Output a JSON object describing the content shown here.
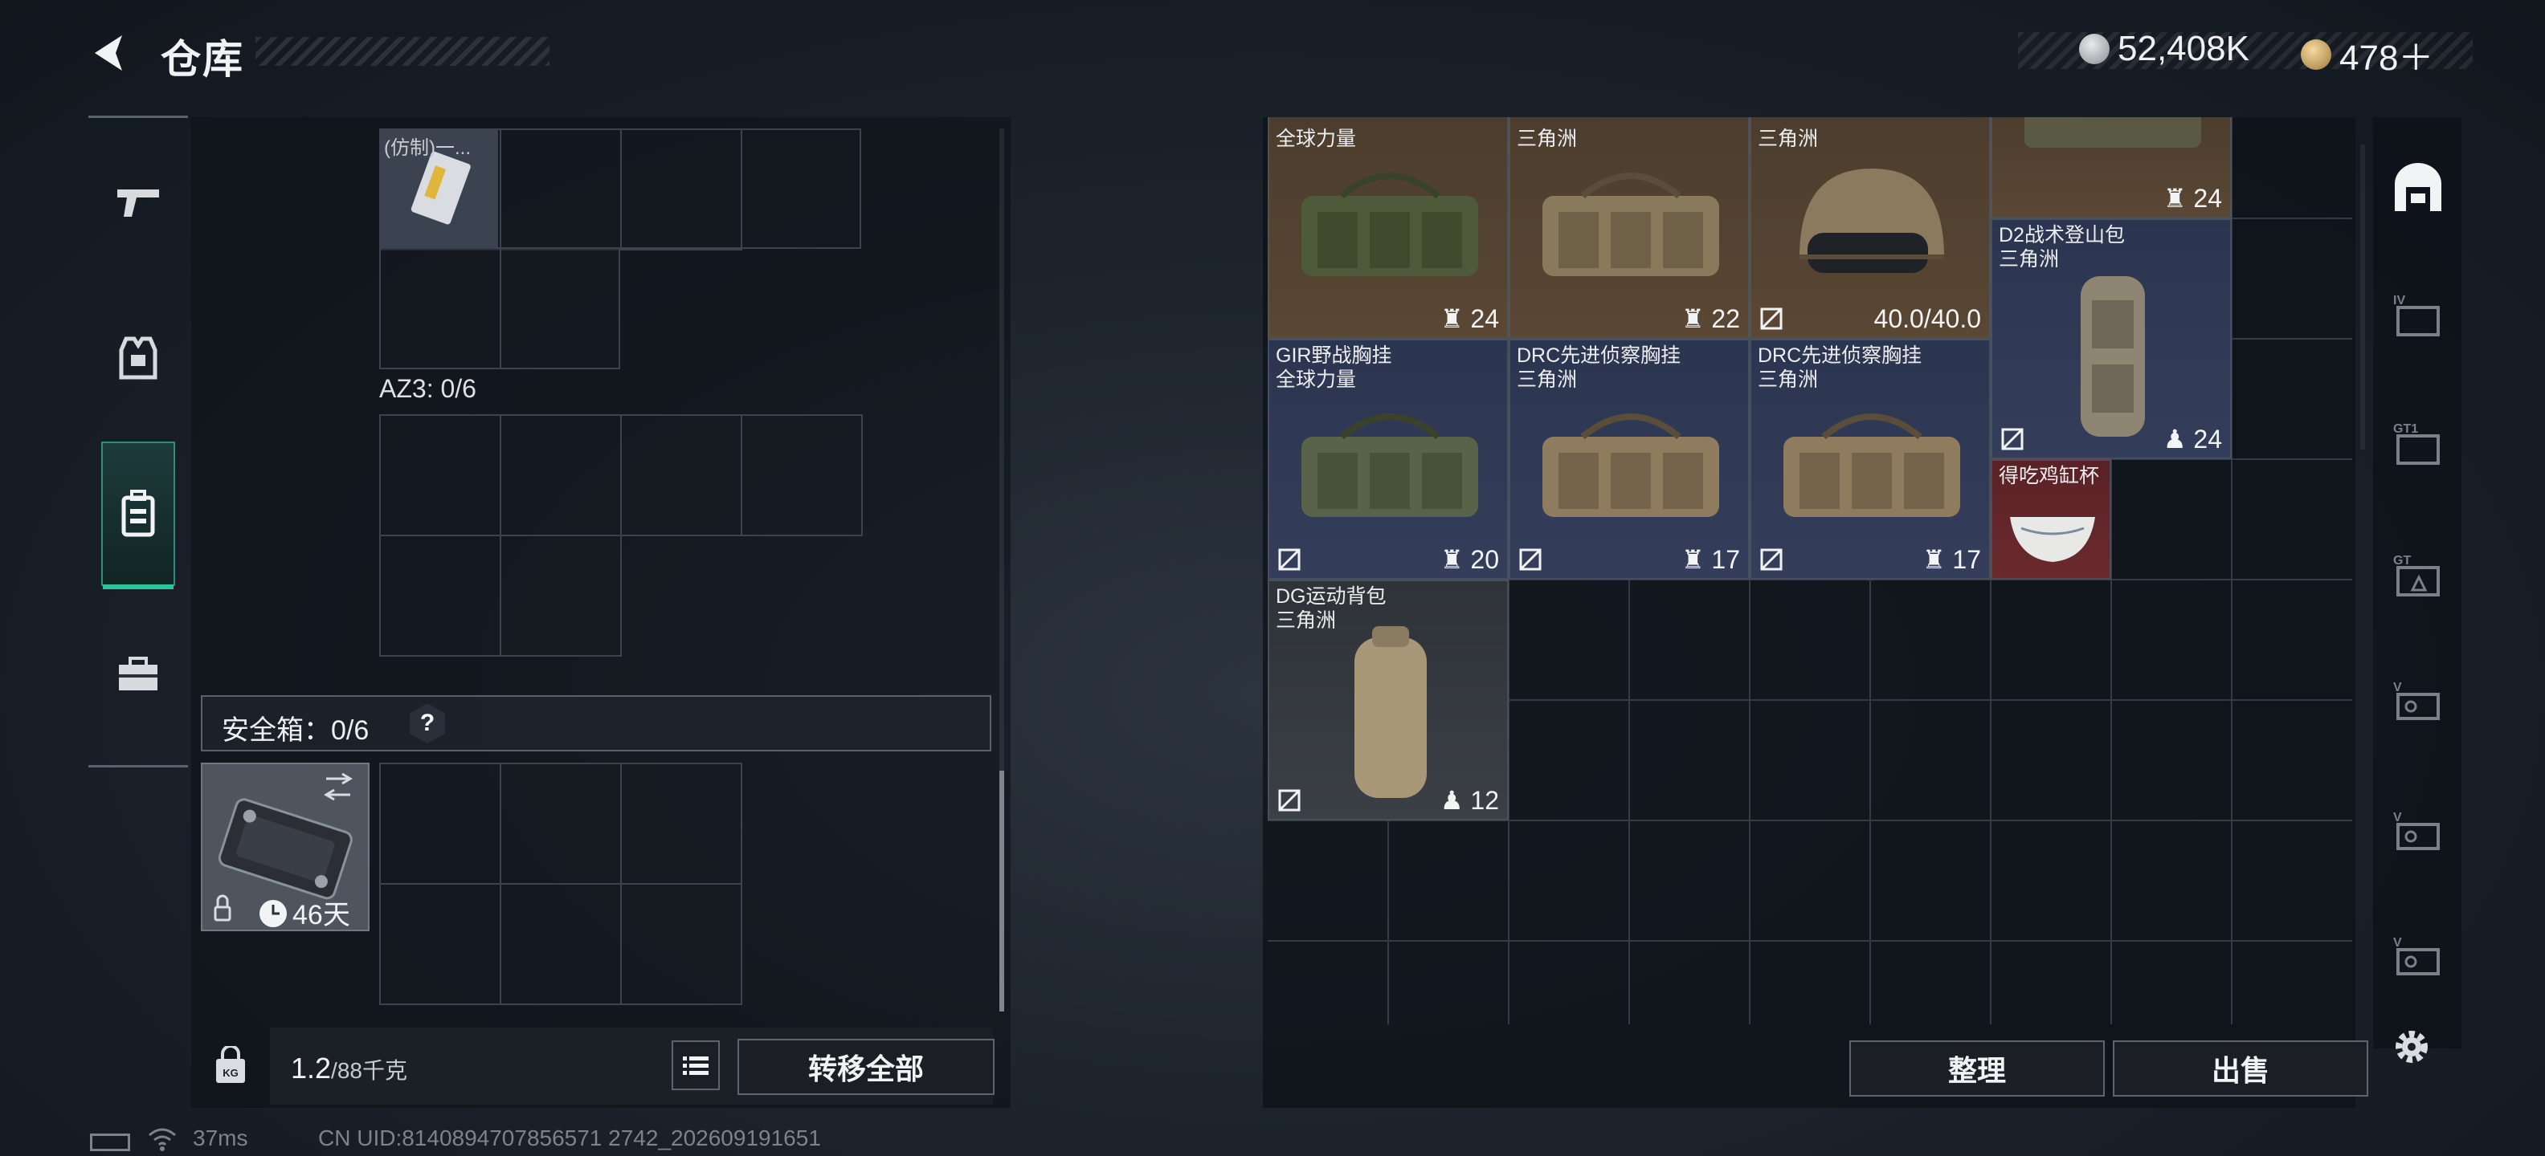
{
  "header": {
    "title": "仓库",
    "currency_silver": "52,408K",
    "currency_gold": "478＋"
  },
  "left_tabs": [
    {
      "name": "weapons-tab-icon"
    },
    {
      "name": "equipment-tab-icon"
    },
    {
      "name": "backpack-tab-icon",
      "active": true
    },
    {
      "name": "toolbox-tab-icon"
    }
  ],
  "left_panel": {
    "top_item_label": "(仿制)一...",
    "az3_label": "AZ3: 0/6",
    "safe_box_label": "安全箱：0/6",
    "help_label": "?",
    "safe_days": "46天",
    "weight_value": "1.2",
    "weight_max": "/88千克",
    "transfer_all": "转移全部"
  },
  "items": [
    {
      "name_line1": "",
      "name_line2": "全球力量",
      "count": "24",
      "icon": "chest-rig"
    },
    {
      "name_line1": "",
      "name_line2": "三角洲",
      "count": "22",
      "icon": "chest-rig"
    },
    {
      "name_line1": "",
      "name_line2": "三角洲",
      "count": "40.0/40.0",
      "icon": "helmet"
    },
    {
      "name_line1": "",
      "name_line2": "",
      "count": "24",
      "icon": "chest-rig"
    },
    {
      "name_line1": "D2战术登山包",
      "name_line2": "三角洲",
      "count": "24",
      "icon": "backpack"
    },
    {
      "name_line1": "GIR野战胸挂",
      "name_line2": "全球力量",
      "count": "20",
      "icon": "chest-rig"
    },
    {
      "name_line1": "DRC先进侦察胸挂",
      "name_line2": "三角洲",
      "count": "17",
      "icon": "chest-rig"
    },
    {
      "name_line1": "DRC先进侦察胸挂",
      "name_line2": "三角洲",
      "count": "17",
      "icon": "chest-rig"
    },
    {
      "name_line1": "得吃鸡缸杯",
      "name_line2": "",
      "count": "",
      "icon": "cup"
    },
    {
      "name_line1": "DG运动背包",
      "name_line2": "三角洲",
      "count": "12",
      "icon": "backpack"
    }
  ],
  "bottom_buttons": {
    "sort": "整理",
    "sell": "出售"
  },
  "status": {
    "ping": "37ms",
    "uid": "CN UID:8140894707856571 2742_202609191651"
  },
  "colors": {
    "accent_teal": "#29c39c",
    "rarity_brown": "#5a4734",
    "rarity_blue": "#303a55",
    "rarity_red": "#5a2226"
  }
}
